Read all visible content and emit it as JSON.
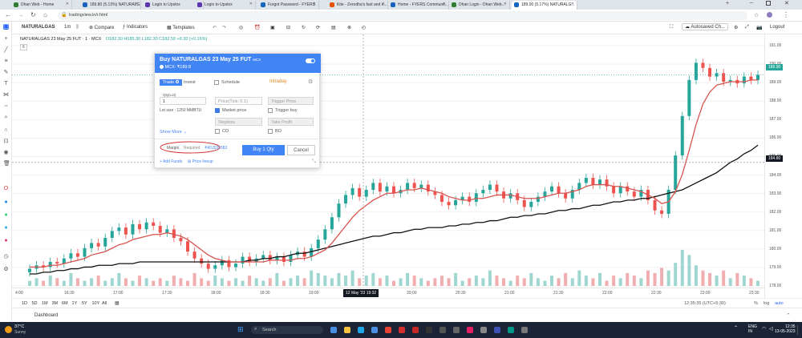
{
  "browser": {
    "tabs": [
      {
        "label": "Dhan Web - Home"
      },
      {
        "label": "189.80 (5.13%) NATURALG..."
      },
      {
        "label": "Login to Upstox"
      },
      {
        "label": "Login to Upstox"
      },
      {
        "label": "Forgot Password - FYERS"
      },
      {
        "label": "Kite - Zerodha's fast and e..."
      },
      {
        "label": "Home - FYERS Communit..."
      },
      {
        "label": "Dhan Login - Dhan Web..."
      },
      {
        "label": "189.90 (5.17%) NATURALG..."
      }
    ],
    "url": "tradingview.in/r.html"
  },
  "toolbar": {
    "symbol": "NATURALGAS",
    "interval": "1m",
    "compare": "Compare",
    "indicators": "Indicators",
    "templates": "Templates",
    "autosaved": "Autosaved Ch...",
    "logout": "Logout"
  },
  "legend": {
    "title": "NATURALGAS 23 May 25 FUT · 1 · MCX",
    "ohlc": "O182.30 H185.30 L182.30 C182.50 +0.30 (+0.16%)",
    "sub": "6"
  },
  "order": {
    "title": "Buy NATURALGAS 23 May 25 FUT",
    "exchange_badge": "MCX",
    "exchange_line": "MCX: ₹189.8",
    "tab_trade": "Trade",
    "tab_invest": "Invest",
    "schedule": "Schedule",
    "intraday": "Intraday",
    "qty_label": "Qty(Lot)",
    "qty_value": "1",
    "lot_size": "Lot size : 1250 MMBTU",
    "price_placeholder": "Price(Tick: 0.1)",
    "market_price": "Market price",
    "trigger_price": "Trigger Price",
    "trigger_buy": "Trigger buy",
    "stoploss": "Stoploss",
    "take_profit": "Take Profit",
    "co": "CO",
    "bo": "BO",
    "show_more": "Show More",
    "margin_label": "Margin",
    "required_label": "Required",
    "margin_value": "₹40,828.583",
    "buy_button": "Buy 1 Qty",
    "cancel_button": "Cancel",
    "add_funds": "+ Add Funds",
    "price_lineup": "Price lineup"
  },
  "price_axis": [
    "191.00",
    "190.00",
    "189.00",
    "188.00",
    "187.00",
    "186.00",
    "185.00",
    "184.00",
    "183.00",
    "182.00",
    "181.00",
    "180.00",
    "179.00",
    "178.00"
  ],
  "price_tags": {
    "last": "189.90",
    "crosshair": "184.80"
  },
  "time_axis": [
    "4:00",
    "16:30",
    "17:00",
    "17:30",
    "18:00",
    "18:30",
    "19:00",
    "19:30",
    "20:00",
    "20:30",
    "21:00",
    "21:30",
    "22:00",
    "22:30",
    "23:00",
    "23:30"
  ],
  "time_cursor": "12 May '23  19:32",
  "ranges": [
    "1D",
    "5D",
    "1M",
    "3M",
    "6M",
    "1Y",
    "5Y",
    "10Y",
    "All"
  ],
  "status": {
    "clock": "12:35:35 (UTC+5:30)",
    "percent": "%",
    "log": "log",
    "auto": "auto"
  },
  "footer": {
    "dashboard": "Dashboard"
  },
  "taskbar": {
    "temp": "37°C",
    "weather": "Sunny",
    "search": "Search",
    "lang": "ENG",
    "region": "IN",
    "time": "12:35",
    "date": "13-05-2023"
  },
  "chart_data": {
    "type": "line",
    "symbol": "NATURALGAS 23 May 25 FUT",
    "ylim": [
      177.6,
      191.6
    ],
    "close": [
      178.6,
      178.8,
      178.7,
      179.0,
      178.9,
      179.2,
      179.5,
      179.3,
      179.8,
      180.1,
      179.9,
      180.4,
      180.8,
      181.0,
      180.6,
      181.2,
      180.9,
      181.3,
      181.1,
      180.7,
      180.9,
      180.4,
      180.2,
      179.6,
      179.2,
      178.9,
      178.6,
      178.8,
      179.1,
      178.7,
      178.9,
      179.3,
      179.0,
      179.2,
      179.4,
      179.1,
      179.3,
      179.0,
      179.4,
      179.6,
      179.3,
      179.8,
      180.3,
      180.9,
      181.6,
      182.4,
      182.9,
      183.3,
      182.8,
      183.2,
      183.6,
      183.1,
      183.4,
      183.0,
      183.2,
      183.6,
      183.3,
      183.5,
      183.1,
      182.9,
      182.5,
      182.3,
      182.6,
      182.8,
      182.5,
      183.0,
      183.2,
      183.5,
      183.1,
      182.7,
      183.0,
      182.6,
      182.2,
      182.5,
      182.8,
      183.1,
      183.4,
      183.0,
      182.7,
      183.2,
      183.6,
      183.9,
      183.5,
      183.8,
      183.4,
      183.0,
      183.4,
      183.1,
      182.8,
      183.2,
      182.6,
      182.0,
      181.8,
      183.2,
      185.2,
      187.5,
      189.6,
      190.6,
      190.3,
      189.8,
      190.0,
      189.5,
      189.6,
      189.4,
      189.8,
      189.6,
      189.9
    ],
    "ema_red": [
      178.7,
      178.7,
      178.7,
      178.8,
      178.8,
      178.9,
      179.0,
      179.1,
      179.2,
      179.4,
      179.5,
      179.6,
      179.8,
      180.0,
      180.1,
      180.3,
      180.4,
      180.5,
      180.6,
      180.6,
      180.7,
      180.6,
      180.5,
      180.3,
      180.0,
      179.7,
      179.4,
      179.2,
      179.1,
      179.0,
      179.0,
      179.0,
      179.0,
      179.0,
      179.0,
      179.1,
      179.1,
      179.1,
      179.1,
      179.2,
      179.2,
      179.3,
      179.5,
      179.7,
      180.1,
      180.6,
      181.1,
      181.6,
      182.0,
      182.3,
      182.6,
      182.8,
      183.0,
      183.0,
      183.1,
      183.2,
      183.2,
      183.3,
      183.2,
      183.1,
      183.0,
      182.8,
      182.7,
      182.6,
      182.6,
      182.7,
      182.7,
      182.8,
      182.9,
      182.9,
      182.9,
      182.8,
      182.7,
      182.7,
      182.7,
      182.8,
      182.9,
      183.0,
      183.0,
      183.1,
      183.2,
      183.4,
      183.5,
      183.5,
      183.5,
      183.4,
      183.4,
      183.3,
      183.2,
      183.1,
      182.9,
      182.7,
      182.4,
      182.5,
      183.1,
      184.1,
      185.5,
      187.0,
      188.2,
      188.9,
      189.3,
      189.4,
      189.5,
      189.5,
      189.5,
      189.6,
      189.6
    ],
    "sma_black": [
      178.3,
      178.3,
      178.4,
      178.4,
      178.5,
      178.5,
      178.6,
      178.6,
      178.7,
      178.7,
      178.8,
      178.8,
      178.8,
      178.9,
      178.9,
      178.9,
      179.0,
      179.0,
      179.0,
      179.0,
      179.0,
      179.0,
      179.0,
      179.0,
      179.0,
      179.0,
      179.0,
      179.0,
      179.0,
      179.0,
      179.0,
      179.0,
      179.1,
      179.1,
      179.2,
      179.2,
      179.3,
      179.3,
      179.4,
      179.5,
      179.5,
      179.6,
      179.7,
      179.8,
      179.9,
      180.0,
      180.1,
      180.2,
      180.3,
      180.4,
      180.5,
      180.5,
      180.6,
      180.7,
      180.7,
      180.8,
      180.9,
      180.9,
      181.0,
      181.0,
      181.0,
      181.1,
      181.1,
      181.2,
      181.2,
      181.3,
      181.3,
      181.4,
      181.4,
      181.5,
      181.6,
      181.6,
      181.7,
      181.7,
      181.8,
      181.8,
      181.9,
      182.0,
      182.0,
      182.1,
      182.1,
      182.2,
      182.3,
      182.3,
      182.4,
      182.5,
      182.5,
      182.6,
      182.6,
      182.7,
      182.7,
      182.8,
      182.9,
      183.0,
      183.1,
      183.2,
      183.4,
      183.6,
      183.8,
      184.0,
      184.2,
      184.5,
      184.8,
      185.0,
      185.3,
      185.5,
      185.8
    ],
    "volume": [
      2,
      3,
      2,
      4,
      3,
      2,
      5,
      3,
      2,
      3,
      4,
      2,
      3,
      5,
      3,
      2,
      4,
      3,
      2,
      3,
      2,
      4,
      3,
      2,
      5,
      3,
      2,
      4,
      3,
      2,
      3,
      2,
      4,
      3,
      2,
      3,
      5,
      2,
      3,
      4,
      3,
      6,
      5,
      4,
      3,
      5,
      4,
      6,
      3,
      4,
      5,
      3,
      4,
      2,
      3,
      5,
      4,
      3,
      2,
      3,
      4,
      3,
      5,
      2,
      3,
      4,
      3,
      6,
      4,
      3,
      2,
      4,
      3,
      5,
      3,
      2,
      4,
      3,
      5,
      3,
      6,
      4,
      3,
      5,
      2,
      4,
      3,
      5,
      4,
      3,
      6,
      5,
      7,
      6,
      9,
      14,
      12,
      8,
      6,
      5,
      4,
      6,
      3,
      5,
      4,
      3,
      2
    ]
  }
}
